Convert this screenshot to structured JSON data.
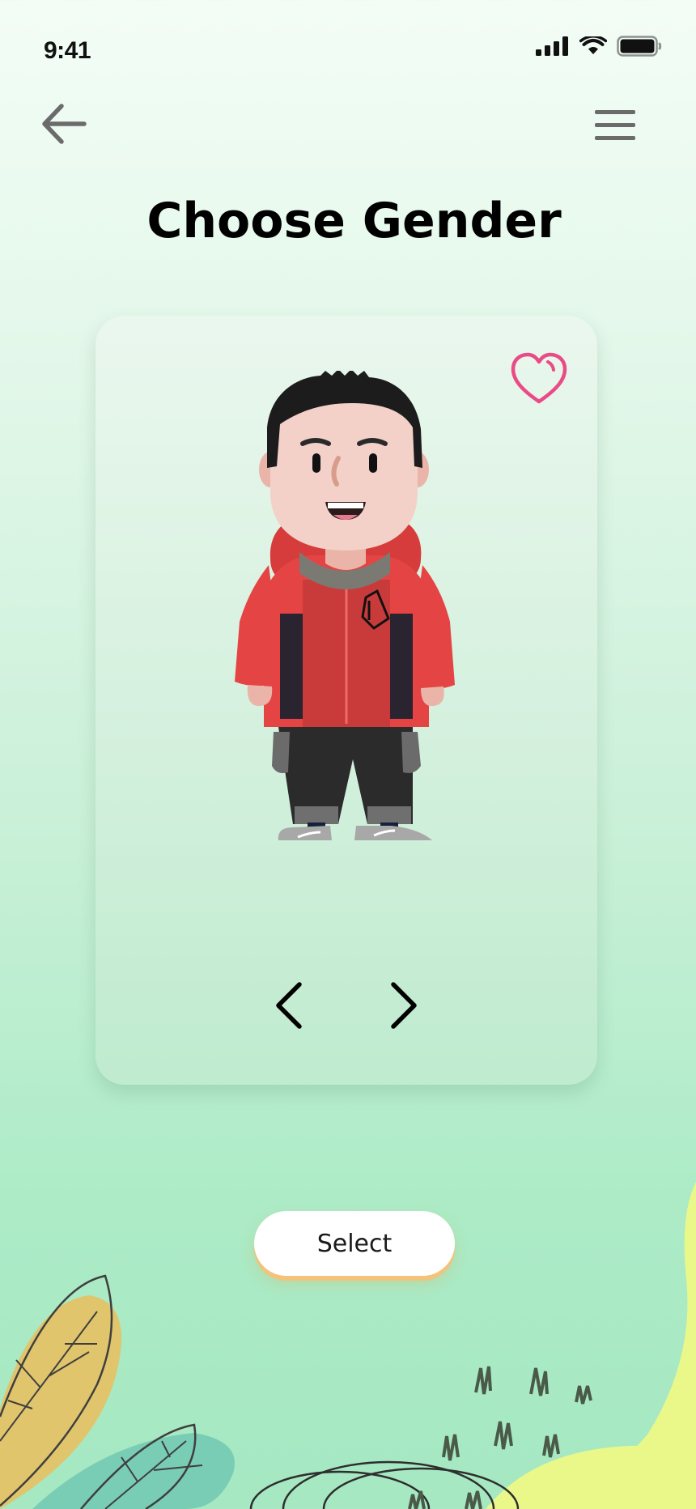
{
  "status_bar": {
    "time": "9:41"
  },
  "header": {
    "back_icon": "arrow-left-icon",
    "menu_icon": "hamburger-menu-icon"
  },
  "page": {
    "title": "Choose Gender"
  },
  "card": {
    "favorite_icon": "heart-icon",
    "avatar": "male-avatar",
    "prev_icon": "chevron-left-icon",
    "next_icon": "chevron-right-icon"
  },
  "actions": {
    "select_label": "Select"
  },
  "colors": {
    "heart": "#e94b86",
    "jacket": "#e54444",
    "button_shadow": "#f3c27b",
    "background_top": "#f3fdf6",
    "background_bottom": "#a5e8c2"
  }
}
